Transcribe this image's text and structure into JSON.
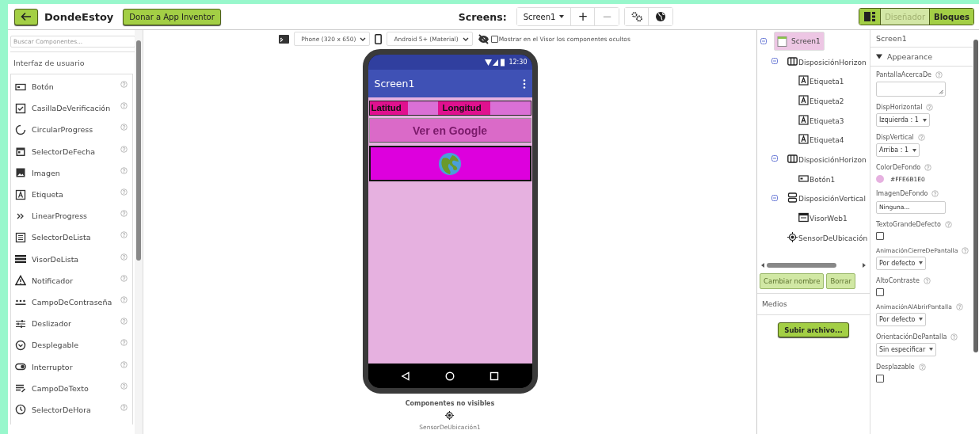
{
  "topbar": {
    "project_title": "DondeEstoy",
    "donate_button": "Donar a App Inventor",
    "screens_label": "Screens:",
    "screen_dropdown": "Screen1",
    "add_screen": "+",
    "remove_screen": "−",
    "modes": [
      {
        "label": "Diseñador",
        "selected": false
      },
      {
        "label": "Bloques",
        "selected": true
      }
    ]
  },
  "palette": {
    "search": {
      "placeholder": "Buscar Componentes..."
    },
    "category": "Interfaz de usuario",
    "items": [
      {
        "label": "Botón",
        "kind": "button"
      },
      {
        "label": "CasillaDeVerificación",
        "kind": "checkbox"
      },
      {
        "label": "CircularProgress",
        "kind": "spinner"
      },
      {
        "label": "SelectorDeFecha",
        "kind": "calendar"
      },
      {
        "label": "Imagen",
        "kind": "image"
      },
      {
        "label": "Etiqueta",
        "kind": "label"
      },
      {
        "label": "LinearProgress",
        "kind": "chevrons"
      },
      {
        "label": "SelectorDeLista",
        "kind": "list"
      },
      {
        "label": "VisorDeLista",
        "kind": "bars"
      },
      {
        "label": "Notificador",
        "kind": "warning"
      },
      {
        "label": "CampoDeContraseña",
        "kind": "password"
      },
      {
        "label": "Deslizador",
        "kind": "slider"
      },
      {
        "label": "Desplegable",
        "kind": "dropdown"
      },
      {
        "label": "Interruptor",
        "kind": "toggle"
      },
      {
        "label": "CampoDeTexto",
        "kind": "textfield"
      },
      {
        "label": "SelectorDeHora",
        "kind": "clock"
      }
    ]
  },
  "viewer": {
    "phone_size": "Phone (320 x 650)",
    "theme": "Android 5+ (Material)",
    "show_hidden": {
      "label": "Mostrar en el Visor los componentes ocultos",
      "checked": false
    },
    "phone": {
      "time": "12:30",
      "app_title": "Screen1",
      "labels": [
        {
          "text": "Latitud",
          "color": "#e0118f"
        },
        {
          "color": "#da70d6"
        },
        {
          "text": "Longitud",
          "color": "#e0118f"
        },
        {
          "color": "#da70d6"
        }
      ],
      "button": "Ver en Google"
    },
    "nonvisible_title": "Componentes no visibles",
    "nonvisible": [
      {
        "label": "SensorDeUbicación1"
      }
    ]
  },
  "tree": {
    "items": [
      {
        "label": "Screen1",
        "kind": "screen",
        "selected": true,
        "expanded": true,
        "children": [
          {
            "label": "DisposiciónHorizon",
            "kind": "hlayout",
            "selected": false,
            "expanded": true,
            "children": [
              {
                "label": "Etiqueta1",
                "kind": "label",
                "selected": false
              },
              {
                "label": "Etiqueta2",
                "kind": "label",
                "selected": false
              },
              {
                "label": "Etiqueta3",
                "kind": "label",
                "selected": false
              },
              {
                "label": "Etiqueta4",
                "kind": "label",
                "selected": false
              }
            ]
          },
          {
            "label": "DisposiciónHorizon",
            "kind": "hlayout",
            "selected": false,
            "expanded": true,
            "children": [
              {
                "label": "Botón1",
                "kind": "button",
                "selected": false
              }
            ]
          },
          {
            "label": "DisposiciónVertical",
            "kind": "vlayout",
            "selected": false,
            "expanded": true,
            "children": [
              {
                "label": "VisorWeb1",
                "kind": "web",
                "selected": false
              }
            ]
          },
          {
            "label": "SensorDeUbicación",
            "kind": "location",
            "selected": false
          }
        ]
      }
    ],
    "rename_button": {
      "label": "Cambiar nombre",
      "disabled": true
    },
    "delete_button": {
      "label": "Borrar",
      "disabled": true
    },
    "media_title": "Medios",
    "upload_button": "Subir archivo..."
  },
  "properties": {
    "component": "Screen1",
    "section": {
      "label": "Appearance",
      "expanded": true
    },
    "items": [
      {
        "name": "PantallaAcercaDe",
        "kind": "textarea"
      },
      {
        "name": "DispHorizontal",
        "kind": "dropdown",
        "value": "Izquierda : 1"
      },
      {
        "name": "DispVertical",
        "kind": "dropdown",
        "value": "Arriba : 1"
      },
      {
        "name": "ColorDeFondo",
        "kind": "color",
        "value": "#FFE6B1E0",
        "color": "#e6b1e0"
      },
      {
        "name": "ImagenDeFondo",
        "kind": "field",
        "value": "Ninguna..."
      },
      {
        "name": "TextoGrandeDefecto",
        "kind": "checkbox",
        "checked": false
      },
      {
        "name": "AnimaciónCierreDePantalla",
        "kind": "dropdown",
        "value": "Por defecto"
      },
      {
        "name": "AltoContraste",
        "kind": "checkbox",
        "checked": false
      },
      {
        "name": "AnimaciónAlAbrirPantalla",
        "kind": "dropdown",
        "value": "Por defecto"
      },
      {
        "name": "OrientaciónDePantalla",
        "kind": "dropdown",
        "value": "Sin especificar"
      },
      {
        "name": "Desplazable",
        "kind": "checkbox",
        "checked": false
      }
    ]
  }
}
